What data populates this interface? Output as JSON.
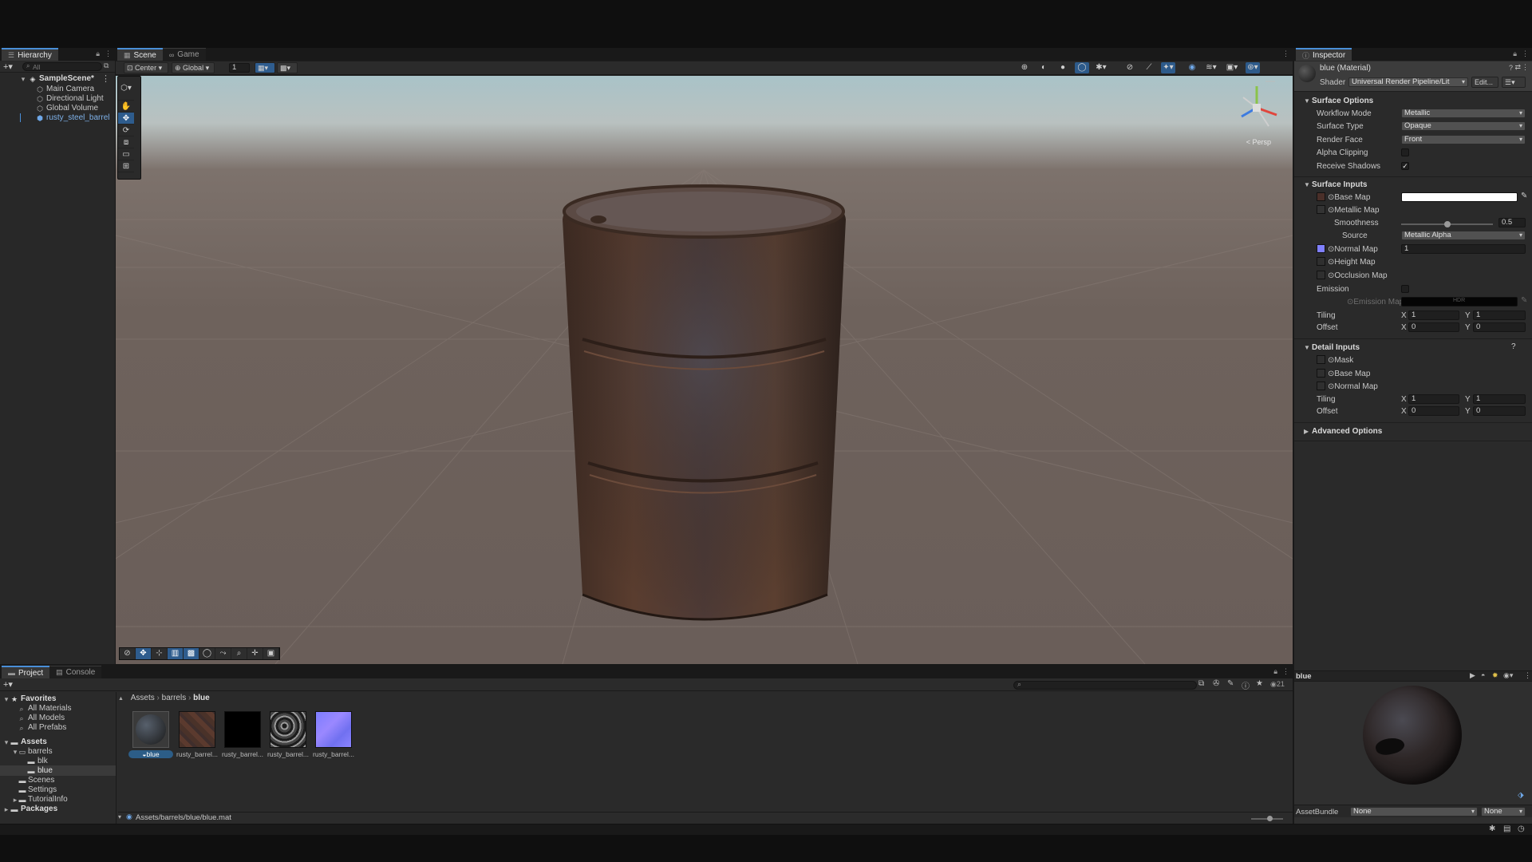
{
  "hierarchy": {
    "tab": "Hierarchy",
    "search_placeholder": "All",
    "scene": "SampleScene*",
    "items": [
      {
        "label": "Main Camera"
      },
      {
        "label": "Directional Light"
      },
      {
        "label": "Global Volume"
      },
      {
        "label": "rusty_steel_barrel"
      }
    ]
  },
  "scene_view": {
    "tabs": [
      "Scene",
      "Game"
    ],
    "pivot": "Center",
    "space": "Global",
    "snap": "1",
    "persp": "< Persp"
  },
  "inspector": {
    "tab": "Inspector",
    "title": "blue (Material)",
    "shader_label": "Shader",
    "shader": "Universal Render Pipeline/Lit",
    "edit_label": "Edit...",
    "surface_options": {
      "header": "Surface Options",
      "workflow_label": "Workflow Mode",
      "workflow": "Metallic",
      "surface_type_label": "Surface Type",
      "surface_type": "Opaque",
      "render_face_label": "Render Face",
      "render_face": "Front",
      "alpha_clipping_label": "Alpha Clipping",
      "receive_shadows_label": "Receive Shadows",
      "receive_shadows_check": "✓"
    },
    "surface_inputs": {
      "header": "Surface Inputs",
      "base_map": "Base Map",
      "metallic_map": "Metallic Map",
      "smoothness_label": "Smoothness",
      "smoothness": "0.5",
      "smoothness_fraction": 0.5,
      "source_label": "Source",
      "source": "Metallic Alpha",
      "normal_map": "Normal Map",
      "normal_value": "1",
      "height_map": "Height Map",
      "occlusion_map": "Occlusion Map",
      "emission_label": "Emission",
      "emission_map": "Emission Map",
      "hdr": "HDR",
      "tiling_label": "Tiling",
      "tiling_x": "1",
      "tiling_y": "1",
      "offset_label": "Offset",
      "offset_x": "0",
      "offset_y": "0"
    },
    "detail_inputs": {
      "header": "Detail Inputs",
      "mask": "Mask",
      "base_map": "Base Map",
      "normal_map": "Normal Map",
      "tiling_label": "Tiling",
      "tiling_x": "1",
      "tiling_y": "1",
      "offset_label": "Offset",
      "offset_x": "0",
      "offset_y": "0"
    },
    "advanced_header": "Advanced Options",
    "axis_x": "X",
    "axis_y": "Y"
  },
  "preview": {
    "title": "blue",
    "assetbundle_label": "AssetBundle",
    "assetbundle": "None",
    "variant": "None"
  },
  "project": {
    "tabs": [
      "Project",
      "Console"
    ],
    "favorites": "Favorites",
    "fav_items": [
      "All Materials",
      "All Models",
      "All Prefabs"
    ],
    "assets": "Assets",
    "tree": [
      {
        "label": "barrels"
      },
      {
        "label": "blk"
      },
      {
        "label": "blue"
      },
      {
        "label": "Scenes"
      },
      {
        "label": "Settings"
      },
      {
        "label": "TutorialInfo"
      }
    ],
    "packages": "Packages",
    "breadcrumb": [
      "Assets",
      "barrels",
      "blue"
    ],
    "count": "21",
    "grid_items": [
      {
        "label": "blue"
      },
      {
        "label": "rusty_barrel..."
      },
      {
        "label": "rusty_barrel..."
      },
      {
        "label": "rusty_barrel..."
      },
      {
        "label": "rusty_barrel..."
      }
    ],
    "status_path": "Assets/barrels/blue/blue.mat"
  },
  "colors": {
    "accent": "#4a8fd8",
    "selection": "#2c5d87",
    "normal_map": "#8080ff"
  }
}
